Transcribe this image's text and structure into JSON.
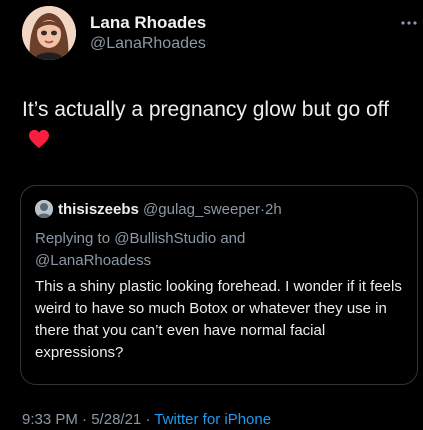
{
  "tweet": {
    "author": {
      "display_name": "Lana Rhoades",
      "handle": "@LanaRhoades"
    },
    "text": "It’s actually a pregnancy glow but go off",
    "emoji_icon": "red-heart-icon",
    "meta": {
      "time": "9:33 PM",
      "separator": "·",
      "date": "5/28/21",
      "source": "Twitter for iPhone"
    }
  },
  "quoted_tweet": {
    "display_name": "thisiszeebs",
    "handle": "@gulag_sweeper",
    "separator": "·",
    "time": "2h",
    "replying_prefix": "Replying to",
    "replying_to_1": "@BullishStudio",
    "replying_conjunction": "and",
    "replying_to_2": "@LanaRhoadess",
    "text": "This a shiny plastic looking forehead. I wonder if it feels weird to have so much Botox or whatever they use in there that you can’t even have normal facial expressions?"
  },
  "colors": {
    "background": "#000000",
    "link": "#1d9bf0",
    "secondary_text": "#8b98a5",
    "border": "#2f3336",
    "heart": "#f91d3f"
  }
}
